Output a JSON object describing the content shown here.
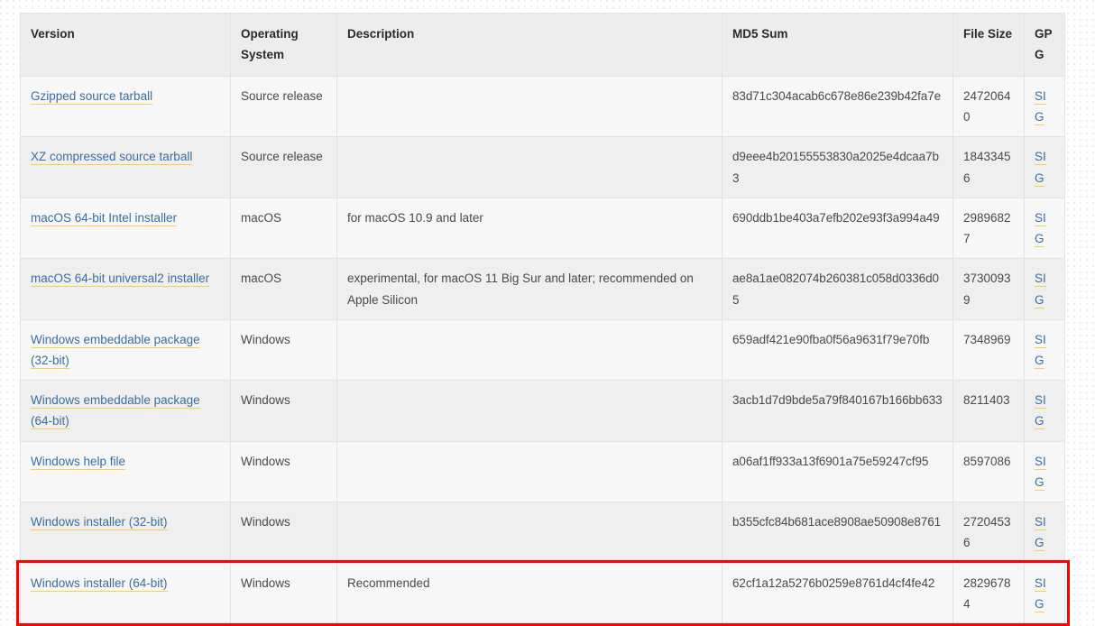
{
  "table": {
    "columns": [
      {
        "key": "version",
        "label": "Version"
      },
      {
        "key": "os",
        "label": "Operating System"
      },
      {
        "key": "description",
        "label": "Description"
      },
      {
        "key": "md5",
        "label": "MD5 Sum"
      },
      {
        "key": "filesize",
        "label": "File Size"
      },
      {
        "key": "gpg",
        "label": "GPG"
      }
    ],
    "gpg_link_label": "SIG",
    "rows": [
      {
        "version": "Gzipped source tarball",
        "os": "Source release",
        "description": "",
        "md5": "83d71c304acab6c678e86e239b42fa7e",
        "filesize": "24720640",
        "gpg": "SIG"
      },
      {
        "version": "XZ compressed source tarball",
        "os": "Source release",
        "description": "",
        "md5": "d9eee4b20155553830a2025e4dcaa7b3",
        "filesize": "18433456",
        "gpg": "SIG"
      },
      {
        "version": "macOS 64-bit Intel installer",
        "os": "macOS",
        "description": "for macOS 10.9 and later",
        "md5": "690ddb1be403a7efb202e93f3a994a49",
        "filesize": "29896827",
        "gpg": "SIG"
      },
      {
        "version": "macOS 64-bit universal2 installer",
        "os": "macOS",
        "description": "experimental, for macOS 11 Big Sur and later; recommended on Apple Silicon",
        "md5": "ae8a1ae082074b260381c058d0336d05",
        "filesize": "37300939",
        "gpg": "SIG"
      },
      {
        "version": "Windows embeddable package (32-bit)",
        "os": "Windows",
        "description": "",
        "md5": "659adf421e90fba0f56a9631f79e70fb",
        "filesize": "7348969",
        "gpg": "SIG"
      },
      {
        "version": "Windows embeddable package (64-bit)",
        "os": "Windows",
        "description": "",
        "md5": "3acb1d7d9bde5a79f840167b166bb633",
        "filesize": "8211403",
        "gpg": "SIG"
      },
      {
        "version": "Windows help file",
        "os": "Windows",
        "description": "",
        "md5": "a06af1ff933a13f6901a75e59247cf95",
        "filesize": "8597086",
        "gpg": "SIG"
      },
      {
        "version": "Windows installer (32-bit)",
        "os": "Windows",
        "description": "",
        "md5": "b355cfc84b681ace8908ae50908e8761",
        "filesize": "27204536",
        "gpg": "SIG"
      },
      {
        "version": "Windows installer (64-bit)",
        "os": "Windows",
        "description": "Recommended",
        "md5": "62cf1a12a5276b0259e8761d4cf4fe42",
        "filesize": "28296784",
        "gpg": "SIG",
        "highlighted": true
      }
    ]
  },
  "annotation": {
    "color": "#ff0000",
    "target_row_index": 8
  }
}
